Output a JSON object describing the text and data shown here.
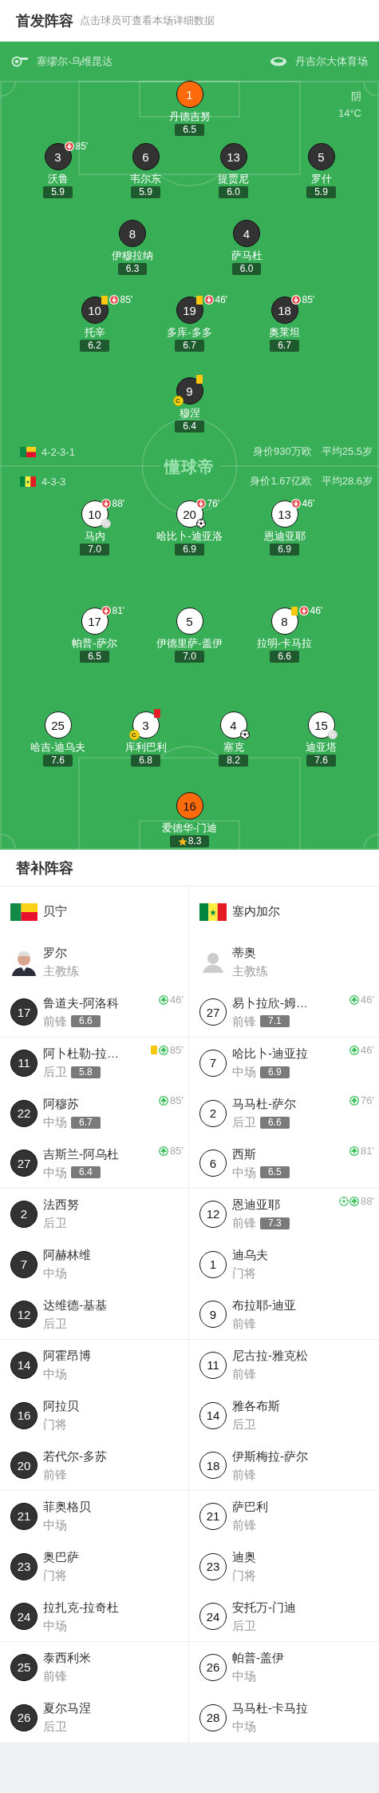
{
  "header": {
    "title": "首发阵容",
    "hint": "点击球员可查看本场详细数据"
  },
  "pitch": {
    "referee": "塞缪尔-乌维昆达",
    "stadium": "丹吉尔大体育场",
    "weather": "阴",
    "temperature": "14°C",
    "logo": "懂球帝"
  },
  "teams": [
    {
      "name": "贝宁",
      "formation": "4-2-3-1",
      "value": "身价930万欧",
      "age": "平均25.5岁",
      "lines": [
        [
          {
            "number": "1",
            "name": "丹德吉努",
            "rating": "6.5",
            "kind": "goalkeeper"
          }
        ],
        [
          {
            "number": "3",
            "name": "沃鲁",
            "rating": "5.9",
            "kind": "outfield",
            "events": [
              {
                "kind": "sub_off",
                "minute": "85'"
              }
            ]
          },
          {
            "number": "6",
            "name": "韦尔东",
            "rating": "5.9",
            "kind": "outfield"
          },
          {
            "number": "13",
            "name": "提贾尼",
            "rating": "6.0",
            "kind": "outfield"
          },
          {
            "number": "5",
            "name": "罗什",
            "rating": "5.9",
            "kind": "outfield"
          }
        ],
        [
          {
            "number": "8",
            "name": "伊穆拉纳",
            "rating": "6.3",
            "kind": "outfield"
          },
          {
            "number": "4",
            "name": "萨马杜",
            "rating": "6.0",
            "kind": "outfield"
          }
        ],
        [
          {
            "number": "10",
            "name": "托辛",
            "rating": "6.2",
            "kind": "outfield",
            "events": [
              {
                "kind": "yellow"
              },
              {
                "kind": "sub_off",
                "minute": "85'"
              }
            ]
          },
          {
            "number": "19",
            "name": "多库-多多",
            "rating": "6.7",
            "kind": "outfield",
            "events": [
              {
                "kind": "yellow"
              },
              {
                "kind": "sub_off",
                "minute": "46'"
              }
            ]
          },
          {
            "number": "18",
            "name": "奥莱坦",
            "rating": "6.7",
            "kind": "outfield",
            "events": [
              {
                "kind": "sub_off",
                "minute": "85'"
              }
            ]
          }
        ],
        [
          {
            "number": "9",
            "name": "穆涅",
            "rating": "6.4",
            "kind": "outfield",
            "events": [
              {
                "kind": "yellow"
              },
              {
                "kind": "captain",
                "label": "C"
              }
            ]
          }
        ]
      ],
      "coach": {
        "name": "罗尔",
        "role": "主教练",
        "kind": "photo"
      },
      "subs": [
        {
          "number": "17",
          "name": "鲁道夫-阿洛科",
          "position": "前锋",
          "rating": "6.6",
          "events": [
            {
              "kind": "sub_on",
              "minute": "46'"
            }
          ]
        },
        {
          "number": "11",
          "name": "阿卜杜勒-拉…",
          "position": "后卫",
          "rating": "5.8",
          "events": [
            {
              "kind": "yellow"
            },
            {
              "kind": "sub_on",
              "minute": "85'"
            }
          ]
        },
        {
          "number": "22",
          "name": "阿穆苏",
          "position": "中场",
          "rating": "6.7",
          "events": [
            {
              "kind": "sub_on",
              "minute": "85'"
            }
          ]
        },
        {
          "number": "27",
          "name": "吉斯兰-阿乌杜",
          "position": "中场",
          "rating": "6.4",
          "events": [
            {
              "kind": "sub_on",
              "minute": "85'"
            }
          ]
        },
        {
          "number": "2",
          "name": "法西努",
          "position": "后卫"
        },
        {
          "number": "7",
          "name": "阿赫林维",
          "position": "中场"
        },
        {
          "number": "12",
          "name": "达维德-基基",
          "position": "后卫"
        },
        {
          "number": "14",
          "name": "阿霍昂博",
          "position": "中场"
        },
        {
          "number": "16",
          "name": "阿拉贝",
          "position": "门将"
        },
        {
          "number": "20",
          "name": "若代尔-多苏",
          "position": "前锋"
        },
        {
          "number": "21",
          "name": "菲奥格贝",
          "position": "中场"
        },
        {
          "number": "23",
          "name": "奥巴萨",
          "position": "门将"
        },
        {
          "number": "24",
          "name": "拉扎克-拉奇杜",
          "position": "中场"
        },
        {
          "number": "25",
          "name": "泰西利米",
          "position": "前锋"
        },
        {
          "number": "26",
          "name": "夏尔马涅",
          "position": "后卫"
        }
      ]
    },
    {
      "name": "塞内加尔",
      "formation": "4-3-3",
      "value": "身价1.67亿欧",
      "age": "平均28.6岁",
      "lines": [
        [
          {
            "number": "10",
            "name": "马内",
            "rating": "7.0",
            "kind": "outfield",
            "events": [
              {
                "kind": "sub_off",
                "minute": "88'"
              },
              {
                "kind": "assist"
              }
            ]
          },
          {
            "number": "20",
            "name": "哈比卜-迪亚洛",
            "rating": "6.9",
            "kind": "outfield",
            "events": [
              {
                "kind": "sub_off",
                "minute": "76'"
              },
              {
                "kind": "goal"
              }
            ]
          },
          {
            "number": "13",
            "name": "恩迪亚耶",
            "rating": "6.9",
            "kind": "outfield",
            "events": [
              {
                "kind": "sub_off",
                "minute": "46'"
              }
            ]
          }
        ],
        [
          {
            "number": "17",
            "name": "帕普-萨尔",
            "rating": "6.5",
            "kind": "outfield",
            "events": [
              {
                "kind": "sub_off",
                "minute": "81'"
              }
            ]
          },
          {
            "number": "5",
            "name": "伊德里萨-盖伊",
            "rating": "7.0",
            "kind": "outfield"
          },
          {
            "number": "8",
            "name": "拉明-卡马拉",
            "rating": "6.6",
            "kind": "outfield",
            "events": [
              {
                "kind": "yellow"
              },
              {
                "kind": "sub_off",
                "minute": "46'"
              }
            ]
          }
        ],
        [
          {
            "number": "25",
            "name": "哈吉-迪乌夫",
            "rating": "7.6",
            "kind": "outfield"
          },
          {
            "number": "3",
            "name": "库利巴利",
            "rating": "6.8",
            "kind": "outfield",
            "events": [
              {
                "kind": "red"
              },
              {
                "kind": "captain",
                "label": "C"
              }
            ]
          },
          {
            "number": "4",
            "name": "塞克",
            "rating": "8.2",
            "kind": "outfield",
            "events": [
              {
                "kind": "goal"
              }
            ]
          },
          {
            "number": "15",
            "name": "迪亚塔",
            "rating": "7.6",
            "kind": "outfield",
            "events": [
              {
                "kind": "assist"
              }
            ]
          }
        ],
        [
          {
            "number": "16",
            "name": "爱德华-门迪",
            "rating": "8.3",
            "kind": "goalkeeper",
            "events": [
              {
                "kind": "motm"
              }
            ]
          }
        ]
      ],
      "coach": {
        "name": "蒂奥",
        "role": "主教练",
        "kind": "placeholder"
      },
      "subs": [
        {
          "number": "27",
          "name": "易卜拉欣-姆…",
          "position": "前锋",
          "rating": "7.1",
          "events": [
            {
              "kind": "sub_on",
              "minute": "46'"
            }
          ]
        },
        {
          "number": "7",
          "name": "哈比卜-迪亚拉",
          "position": "中场",
          "rating": "6.9",
          "events": [
            {
              "kind": "sub_on",
              "minute": "46'"
            }
          ]
        },
        {
          "number": "2",
          "name": "马马杜-萨尔",
          "position": "后卫",
          "rating": "6.6",
          "events": [
            {
              "kind": "sub_on",
              "minute": "76'"
            }
          ]
        },
        {
          "number": "6",
          "name": "西斯",
          "position": "中场",
          "rating": "6.5",
          "events": [
            {
              "kind": "sub_on",
              "minute": "81'"
            }
          ]
        },
        {
          "number": "12",
          "name": "恩迪亚耶",
          "position": "前锋",
          "rating": "7.3",
          "events": [
            {
              "kind": "goal"
            },
            {
              "kind": "sub_on",
              "minute": "88'"
            }
          ]
        },
        {
          "number": "1",
          "name": "迪乌夫",
          "position": "门将"
        },
        {
          "number": "9",
          "name": "布拉耶-迪亚",
          "position": "前锋"
        },
        {
          "number": "11",
          "name": "尼古拉-雅克松",
          "position": "前锋"
        },
        {
          "number": "14",
          "name": "雅各布斯",
          "position": "后卫"
        },
        {
          "number": "18",
          "name": "伊斯梅拉-萨尔",
          "position": "前锋"
        },
        {
          "number": "21",
          "name": "萨巴利",
          "position": "前锋"
        },
        {
          "number": "23",
          "name": "迪奥",
          "position": "门将"
        },
        {
          "number": "24",
          "name": "安托万-门迪",
          "position": "后卫"
        },
        {
          "number": "26",
          "name": "帕普-盖伊",
          "position": "中场"
        },
        {
          "number": "28",
          "name": "马马杜-卡马拉",
          "position": "中场"
        }
      ]
    }
  ],
  "bench": {
    "title": "替补阵容"
  }
}
